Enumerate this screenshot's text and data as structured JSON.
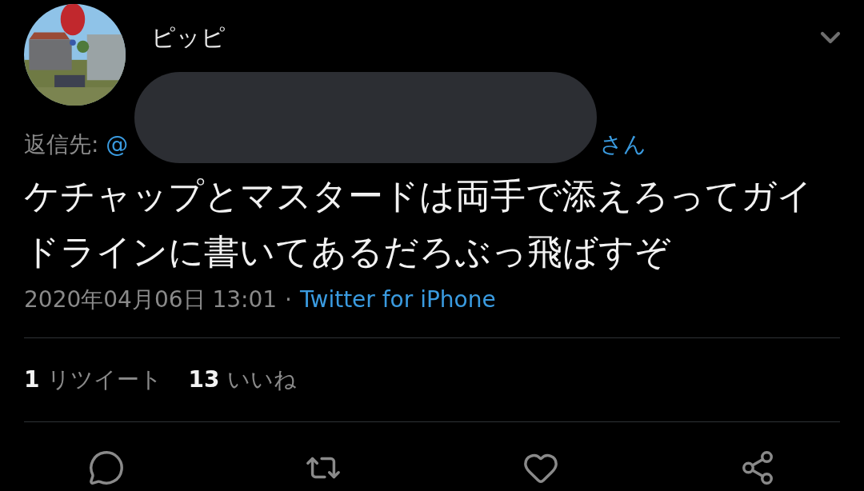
{
  "author": {
    "name": "ピッピ"
  },
  "redacted": true,
  "reply_to": {
    "label": "返信先:",
    "mention": "@",
    "suffix": "さん"
  },
  "text": "ケチャップとマスタードは両手で添えろってガイドラインに書いてあるだろぶっ飛ばすぞ",
  "meta": {
    "timestamp": "2020年04月06日 13:01",
    "separator": "·",
    "source": "Twitter for iPhone"
  },
  "stats": [
    {
      "count": "1",
      "label": "リツイート"
    },
    {
      "count": "13",
      "label": "いいね"
    }
  ],
  "actions": [
    {
      "kind": "reply"
    },
    {
      "kind": "retweet"
    },
    {
      "kind": "like"
    },
    {
      "kind": "share"
    }
  ]
}
